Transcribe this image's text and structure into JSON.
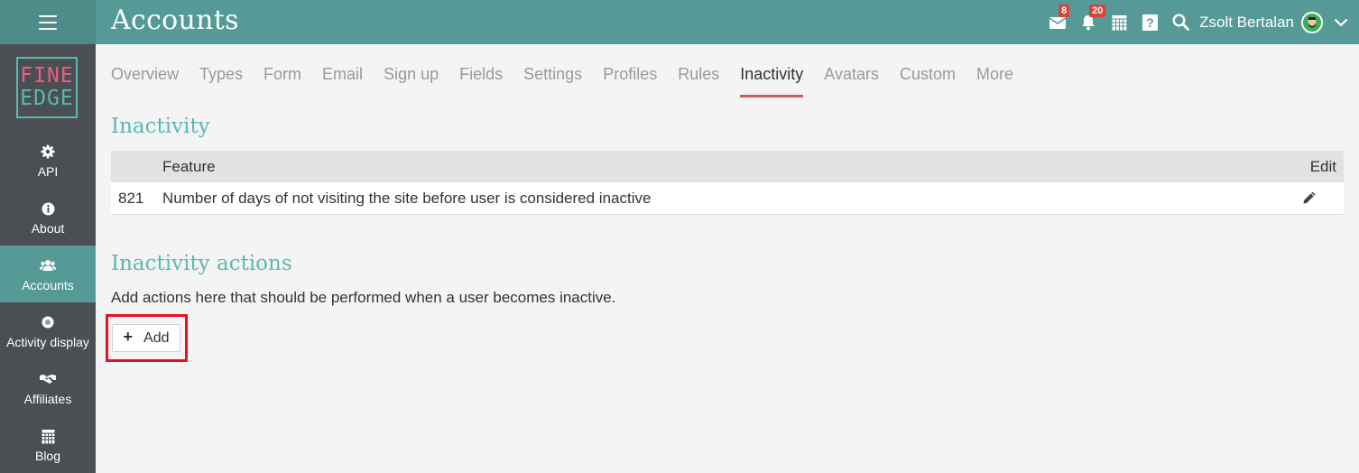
{
  "header": {
    "title": "Accounts",
    "messages_badge": "8",
    "notifications_badge": "20",
    "username": "Zsolt Bertalan"
  },
  "logo": {
    "line1": "FINE",
    "line2": "EDGE"
  },
  "sidebar": {
    "items": [
      {
        "label": "API",
        "icon": "gear-icon"
      },
      {
        "label": "About",
        "icon": "info-icon"
      },
      {
        "label": "Accounts",
        "icon": "users-icon",
        "active": true
      },
      {
        "label": "Activity display",
        "icon": "dot-circle-icon"
      },
      {
        "label": "Affiliates",
        "icon": "handshake-icon"
      },
      {
        "label": "Blog",
        "icon": "calendar-icon"
      }
    ]
  },
  "tabs": [
    {
      "label": "Overview"
    },
    {
      "label": "Types"
    },
    {
      "label": "Form"
    },
    {
      "label": "Email"
    },
    {
      "label": "Sign up"
    },
    {
      "label": "Fields"
    },
    {
      "label": "Settings"
    },
    {
      "label": "Profiles"
    },
    {
      "label": "Rules"
    },
    {
      "label": "Inactivity",
      "active": true
    },
    {
      "label": "Avatars"
    },
    {
      "label": "Custom"
    },
    {
      "label": "More"
    }
  ],
  "inactivity": {
    "heading": "Inactivity",
    "table": {
      "col_feature": "Feature",
      "col_edit": "Edit",
      "rows": [
        {
          "id": "821",
          "feature": "Number of days of not visiting the site before user is considered inactive"
        }
      ]
    }
  },
  "actions": {
    "heading": "Inactivity actions",
    "description": "Add actions here that should be performed when a user becomes inactive.",
    "add_label": "Add"
  },
  "colors": {
    "topbar": "#559a96",
    "sidebar": "#4b4e52",
    "heading": "#5cb8b2",
    "active_tab_underline": "#c9605a",
    "badge": "#d9433a",
    "highlight": "#e3141d"
  }
}
